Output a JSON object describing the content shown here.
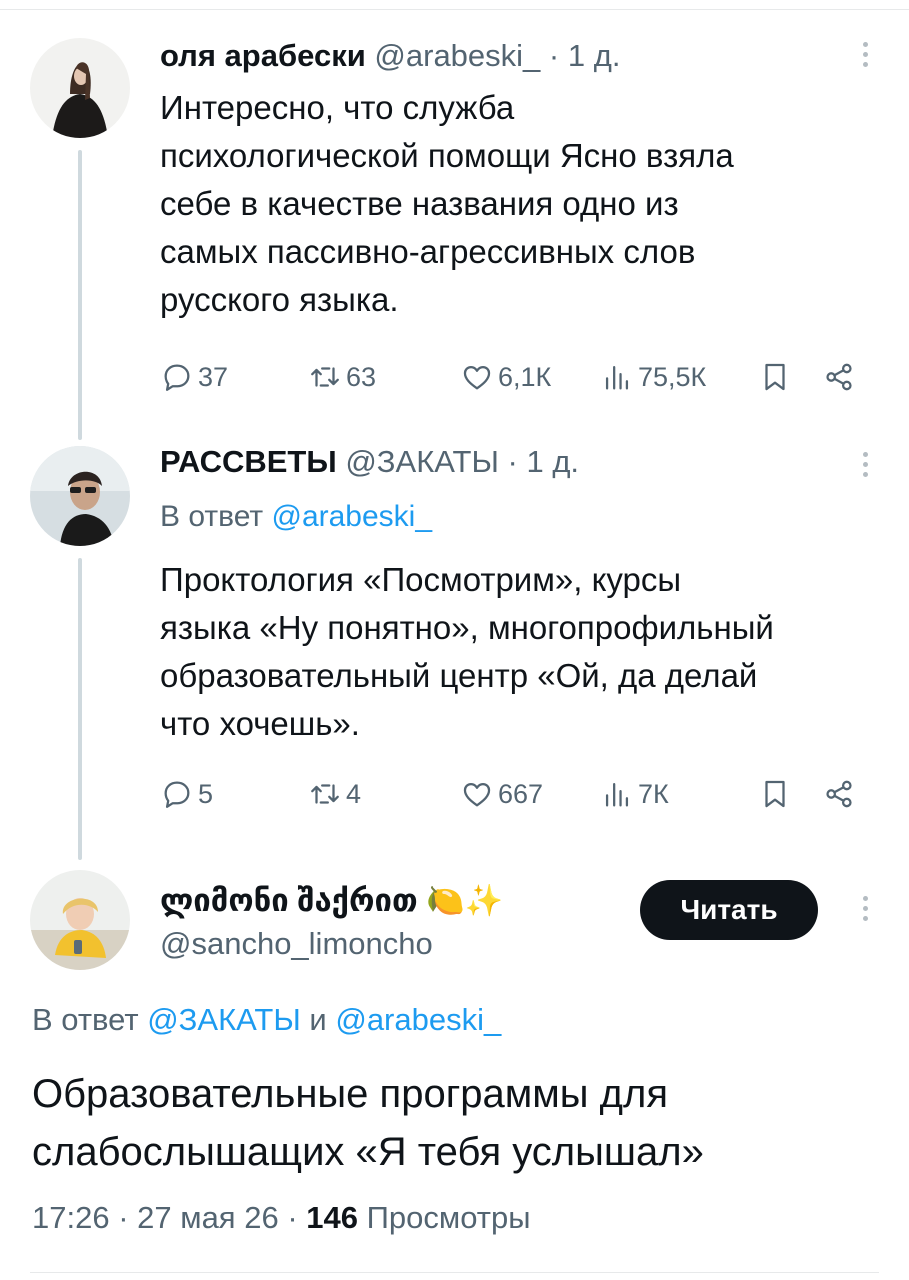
{
  "tweets": [
    {
      "name": "оля арабески",
      "handle": "@arabeski_",
      "dot": "·",
      "time": "1 д.",
      "lines": [
        "Интересно, что служба",
        "психологической помощи Ясно взяла",
        "себе в качестве названия одно из",
        "самых пассивно-агрессивных слов",
        "русского языка."
      ],
      "stats": {
        "replies": "37",
        "retweets": "63",
        "likes": "6,1К",
        "views": "75,5К"
      }
    },
    {
      "name": "РАССВЕТЫ",
      "handle": "@ЗАКАТЫ",
      "dot": "·",
      "time": "1 д.",
      "reply_prefix": "В ответ",
      "reply_to": "@arabeski_",
      "lines": [
        "Проктология «Посмотрим», курсы",
        "языка «Ну понятно», многопрофильный",
        "образовательный центр «Ой, да делай",
        "что хочешь»."
      ],
      "stats": {
        "replies": "5",
        "retweets": "4",
        "likes": "667",
        "views": "7К"
      }
    }
  ],
  "main": {
    "name": "ლიმონი შაქრით 🍋✨",
    "handle": "@sancho_limoncho",
    "follow_label": "Читать",
    "reply_prefix": "В ответ",
    "reply_to_1": "@ЗАКАТЫ",
    "reply_and": "и",
    "reply_to_2": "@arabeski_",
    "lines": [
      "Образовательные программы для",
      "слабослышащих «Я тебя услышал»"
    ],
    "time": "17:26",
    "sep": "·",
    "date": "27 мая 26",
    "views": "146",
    "views_label": "Просмотры"
  },
  "icons": [
    "reply-icon",
    "retweet-icon",
    "like-icon",
    "views-icon",
    "bookmark-icon",
    "share-icon",
    "more-icon"
  ],
  "colors": {
    "link": "#1d9bf0",
    "muted": "#536471",
    "text": "#0f1419",
    "button": "#0f1419"
  }
}
